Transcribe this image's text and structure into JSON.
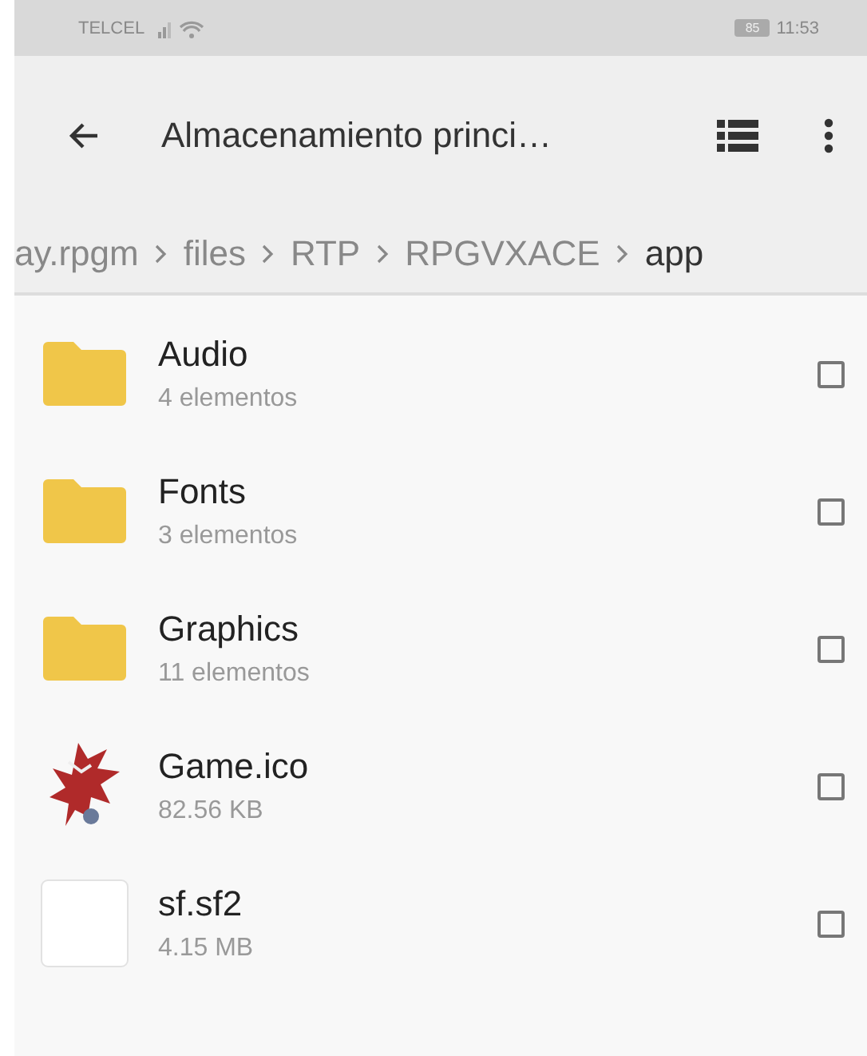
{
  "status_bar": {
    "carrier": "TELCEL",
    "battery": "85",
    "time": "11:53"
  },
  "app_bar": {
    "title": "Almacenamiento princi…"
  },
  "breadcrumb": [
    {
      "label": "ay.rpgm",
      "selected": false
    },
    {
      "label": "files",
      "selected": false
    },
    {
      "label": "RTP",
      "selected": false
    },
    {
      "label": "RPGVXACE",
      "selected": false
    },
    {
      "label": "app",
      "selected": true
    }
  ],
  "files": [
    {
      "kind": "folder",
      "name": "Audio",
      "detail": "4 elementos",
      "checked": false
    },
    {
      "kind": "folder",
      "name": "Fonts",
      "detail": "3 elementos",
      "checked": false
    },
    {
      "kind": "folder",
      "name": "Graphics",
      "detail": "11 elementos",
      "checked": false
    },
    {
      "name": "Game.ico",
      "detail": "82.56 KB",
      "checked": false
    },
    {
      "kind": "file",
      "name": "sf.sf2",
      "detail": "4.15 MB",
      "checked": false
    }
  ]
}
